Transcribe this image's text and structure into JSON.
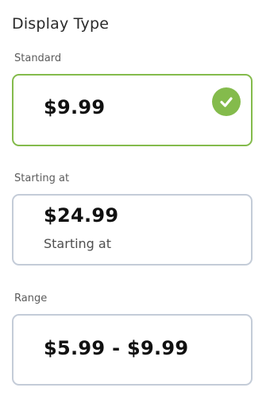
{
  "title": "Display Type",
  "accent_color": "#84bb4c",
  "border_color": "#c4ccd8",
  "options": [
    {
      "section_label": "Standard",
      "price": "$9.99",
      "subtext": "",
      "selected": true
    },
    {
      "section_label": "Starting at",
      "price": "$24.99",
      "subtext": "Starting at",
      "selected": false
    },
    {
      "section_label": "Range",
      "price": "$5.99 - $9.99",
      "subtext": "",
      "selected": false
    }
  ],
  "selected_icon": "check-circle-icon"
}
